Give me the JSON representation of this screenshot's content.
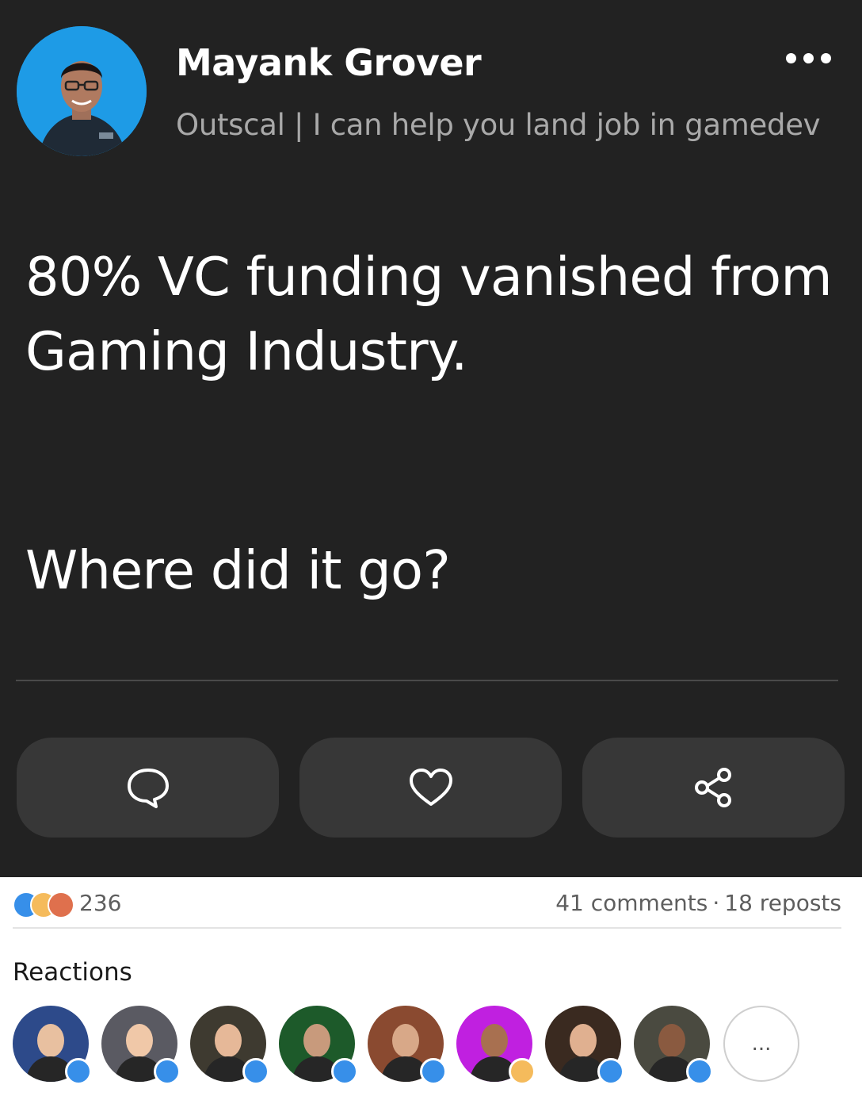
{
  "post": {
    "author_name": "Mayank Grover",
    "author_headline": "Outscal | I can help you land job in gamedev",
    "text_line1": "80% VC funding vanished from Gaming Industry.",
    "text_question": "Where did it go?"
  },
  "actions": {
    "comment_icon": "comment-icon",
    "like_icon": "heart-icon",
    "share_icon": "share-icon"
  },
  "stats": {
    "reaction_count": "236",
    "comments": "41 comments",
    "separator": "·",
    "reposts": "18 reposts"
  },
  "reactions": {
    "title": "Reactions",
    "more_label": "...",
    "reactors": [
      {
        "reaction": "like"
      },
      {
        "reaction": "like"
      },
      {
        "reaction": "like"
      },
      {
        "reaction": "like"
      },
      {
        "reaction": "like"
      },
      {
        "reaction": "insightful"
      },
      {
        "reaction": "like"
      },
      {
        "reaction": "like"
      }
    ]
  },
  "colors": {
    "card_bg": "#222222",
    "button_bg": "#373737",
    "avatar_bg": "#1e9be6",
    "like_blue": "#378fe9",
    "insight_yellow": "#f5bb5c",
    "love_orange": "#df704d"
  }
}
